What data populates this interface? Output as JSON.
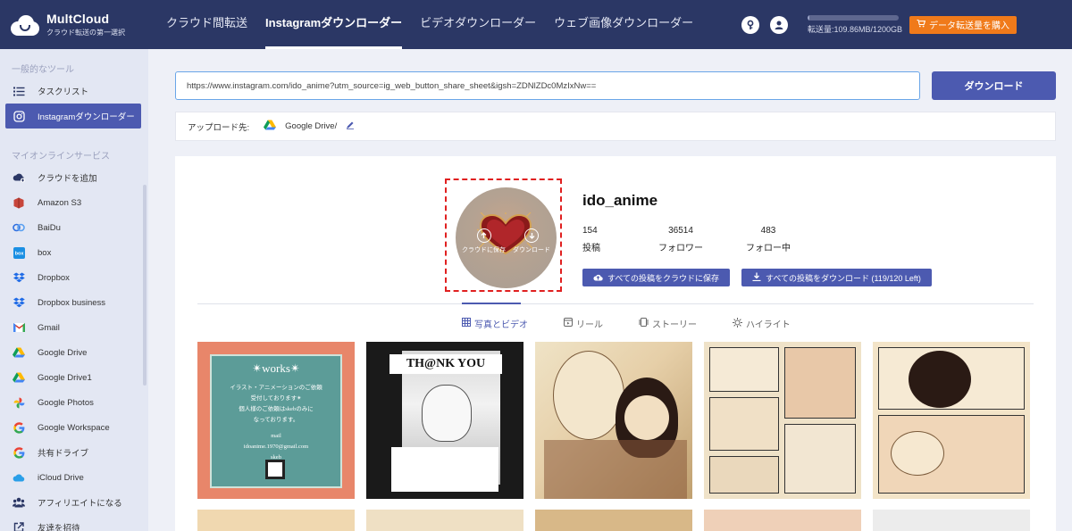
{
  "app": {
    "name": "MultCloud",
    "tagline": "クラウド転送の第一選択"
  },
  "nav": {
    "items": [
      {
        "label": "クラウド間転送"
      },
      {
        "label": "Instagramダウンローダー"
      },
      {
        "label": "ビデオダウンローダー"
      },
      {
        "label": "ウェブ画像ダウンローダー"
      }
    ],
    "active_index": 1
  },
  "header": {
    "transfer_text": "転送量:109.86MB/1200GB",
    "transfer_fraction": 0.0001,
    "buy_label": "データ転送量を購入",
    "icons": [
      "key-icon",
      "user-icon",
      "cart-icon"
    ]
  },
  "sidebar": {
    "section_general": "一般的なツール",
    "general_items": [
      {
        "label": "タスクリスト",
        "icon": "list-icon"
      },
      {
        "label": "Instagramダウンローダー",
        "icon": "instagram-icon"
      }
    ],
    "section_online": "マイオンラインサービス",
    "services": [
      {
        "label": "クラウドを追加",
        "icon": "add-cloud-icon"
      },
      {
        "label": "Amazon S3",
        "icon": "amazon-s3-icon",
        "color": "#c7453b"
      },
      {
        "label": "BaiDu",
        "icon": "baidu-icon",
        "color": "#2f6fe0"
      },
      {
        "label": "box",
        "icon": "box-icon",
        "color": "#1a8fe3"
      },
      {
        "label": "Dropbox",
        "icon": "dropbox-icon",
        "color": "#1f6be6"
      },
      {
        "label": "Dropbox business",
        "icon": "dropbox-icon",
        "color": "#1f6be6"
      },
      {
        "label": "Gmail",
        "icon": "gmail-icon"
      },
      {
        "label": "Google Drive",
        "icon": "google-drive-icon"
      },
      {
        "label": "Google Drive1",
        "icon": "google-drive-icon"
      },
      {
        "label": "Google Photos",
        "icon": "google-photos-icon"
      },
      {
        "label": "Google Workspace",
        "icon": "google-icon"
      },
      {
        "label": "共有ドライブ",
        "icon": "google-icon"
      },
      {
        "label": "iCloud Drive",
        "icon": "icloud-icon",
        "color": "#2a9fe8"
      },
      {
        "label": "アフィリエイトになる",
        "icon": "affiliate-icon"
      },
      {
        "label": "友達を招待",
        "icon": "invite-icon"
      }
    ]
  },
  "search": {
    "url_value": "https://www.instagram.com/ido_anime?utm_source=ig_web_button_share_sheet&igsh=ZDNlZDc0MzIxNw==",
    "download_label": "ダウンロード"
  },
  "upload": {
    "label": "アップロード先:",
    "target": "Google Drive/"
  },
  "profile": {
    "username": "ido_anime",
    "avatar_actions": {
      "save_cloud": "クラウドに保存",
      "download": "ダウンロード"
    },
    "stats": [
      {
        "value": "154",
        "label": "投稿"
      },
      {
        "value": "36514",
        "label": "フォロワー"
      },
      {
        "value": "483",
        "label": "フォロー中"
      }
    ],
    "save_all_label": "すべての投稿をクラウドに保存",
    "download_all_label": "すべての投稿をダウンロード (119/120 Left)"
  },
  "tabs": [
    {
      "label": "写真とビデオ",
      "icon": "grid-icon"
    },
    {
      "label": "リール",
      "icon": "reel-icon"
    },
    {
      "label": "ストーリー",
      "icon": "story-icon"
    },
    {
      "label": "ハイライト",
      "icon": "highlight-icon"
    }
  ],
  "posts": {
    "first": {
      "title": "✴works✴",
      "line1": "イラスト・アニメーションのご依頼",
      "line2": "受付しております✴",
      "line3": "個人様のご依頼はskebのみに",
      "line4": "なっております。",
      "mail_label": "mail",
      "mail": "idoanime.1970@gmail.com",
      "skeb": "skeb"
    },
    "second": {
      "banner": "TH@NK YOU"
    }
  },
  "colors": {
    "topbar": "#2b3765",
    "accent": "#4c5ab0",
    "buy": "#f07a1a",
    "selection": "#e02020"
  }
}
